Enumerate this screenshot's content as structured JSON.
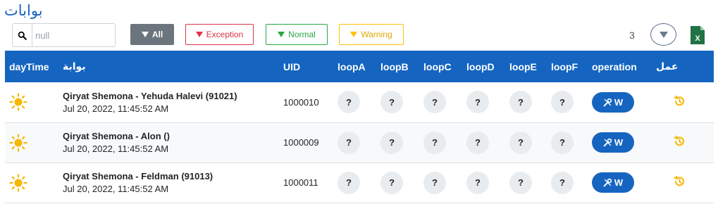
{
  "header": {
    "title": "بوابات"
  },
  "search": {
    "placeholder": "null",
    "value": ""
  },
  "filters": {
    "all": "All",
    "exception": "Exception",
    "normal": "Normal",
    "warning": "Warning"
  },
  "toolbar": {
    "count": "3",
    "funnel_icon": "filter-icon",
    "excel_icon": "excel-export-icon"
  },
  "colors": {
    "primary": "#1565c0",
    "exception": "#dc3545",
    "normal": "#28a745",
    "warning": "#ffc107",
    "sun": "#f5b800"
  },
  "table": {
    "headers": [
      "dayTime",
      "بوابة",
      "UID",
      "loopA",
      "loopB",
      "loopC",
      "loopD",
      "loopE",
      "loopF",
      "operation",
      "عمل"
    ],
    "rows": [
      {
        "icon": "sun-icon",
        "name": "Qiryat Shemona - Yehuda Halevi (91021)",
        "time": "Jul 20, 2022, 11:45:52 AM",
        "uid": "1000010",
        "loops": [
          "?",
          "?",
          "?",
          "?",
          "?",
          "?"
        ],
        "operation": "W"
      },
      {
        "icon": "sun-icon",
        "name": "Qiryat Shemona - Alon ()",
        "time": "Jul 20, 2022, 11:45:52 AM",
        "uid": "1000009",
        "loops": [
          "?",
          "?",
          "?",
          "?",
          "?",
          "?"
        ],
        "operation": "W"
      },
      {
        "icon": "sun-icon",
        "name": "Qiryat Shemona - Feldman (91013)",
        "time": "Jul 20, 2022, 11:45:52 AM",
        "uid": "1000011",
        "loops": [
          "?",
          "?",
          "?",
          "?",
          "?",
          "?"
        ],
        "operation": "W"
      }
    ]
  }
}
